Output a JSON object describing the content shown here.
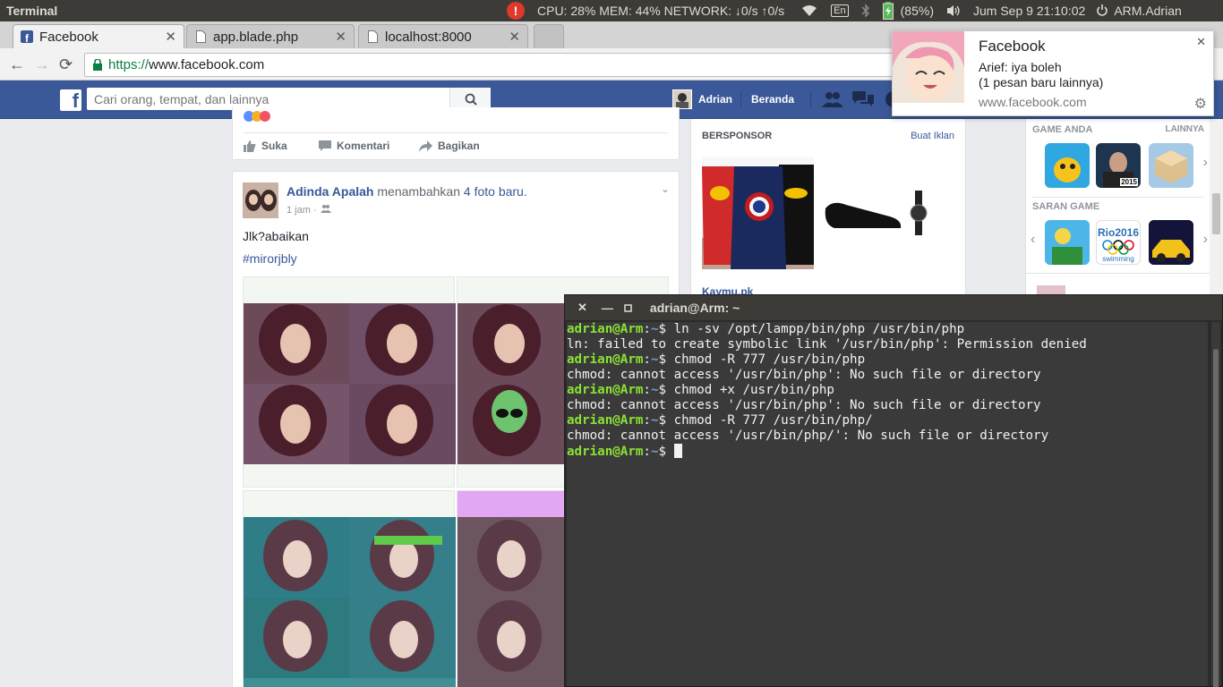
{
  "panel": {
    "app_title": "Terminal",
    "system_stats": "CPU: 28% MEM: 44% NETWORK: ↓0/s ↑0/s",
    "keyboard_layout": "En",
    "battery": "(85%)",
    "datetime": "Jum Sep  9 21:10:02",
    "user": "ARM.Adrian"
  },
  "browser": {
    "tabs": [
      {
        "label": "Facebook",
        "icon": "facebook-icon",
        "active": true
      },
      {
        "label": "app.blade.php",
        "icon": "page-icon",
        "active": false
      },
      {
        "label": "localhost:8000",
        "icon": "page-icon",
        "active": false
      }
    ],
    "url_scheme": "https://",
    "url_host": "www.facebook.com"
  },
  "facebook": {
    "search_placeholder": "Cari orang, tempat, dan lainnya",
    "user_name": "Adrian",
    "home_label": "Beranda",
    "prev_post": {
      "like_label": "Suka",
      "comment_label": "Komentari",
      "share_label": "Bagikan"
    },
    "post": {
      "author": "Adinda Apalah",
      "action": "menambahkan",
      "action_link": "4 foto baru.",
      "time": "1 jam ·",
      "text": "Jlk?abaikan",
      "hashtag": "#mirorjbly"
    },
    "sponsor": {
      "title": "BERSPONSOR",
      "create_ad": "Buat Iklan",
      "advertiser": "Kaymu.pk"
    },
    "games": {
      "your_games": "GAME ANDA",
      "more": "LAINNYA",
      "suggested": "SARAN GAME",
      "game_year_badge": "2015",
      "rio_label": "Rio2016",
      "rio_sub": "swimming"
    }
  },
  "notification": {
    "title": "Facebook",
    "line1": "Arief: iya boleh",
    "line2": "(1 pesan baru lainnya)",
    "source": "www.facebook.com"
  },
  "terminal": {
    "title": "adrian@Arm: ~",
    "prompt_user": "adrian@Arm",
    "prompt_sep": ":",
    "prompt_dir": "~",
    "prompt_end": "$",
    "lines": [
      {
        "type": "cmd",
        "text": " ln -sv /opt/lampp/bin/php /usr/bin/php"
      },
      {
        "type": "out",
        "text": "ln: failed to create symbolic link '/usr/bin/php': Permission denied"
      },
      {
        "type": "cmd",
        "text": " chmod -R 777 /usr/bin/php"
      },
      {
        "type": "out",
        "text": "chmod: cannot access '/usr/bin/php': No such file or directory"
      },
      {
        "type": "cmd",
        "text": " chmod +x /usr/bin/php"
      },
      {
        "type": "out",
        "text": "chmod: cannot access '/usr/bin/php': No such file or directory"
      },
      {
        "type": "cmd",
        "text": " chmod -R 777 /usr/bin/php/"
      },
      {
        "type": "out",
        "text": "chmod: cannot access '/usr/bin/php/': No such file or directory"
      },
      {
        "type": "cmd",
        "text": " "
      }
    ]
  },
  "colors": {
    "facebook_blue": "#3b5998",
    "terminal_bg": "#3a3a3a",
    "prompt_green": "#8ae234",
    "prompt_blue": "#729fcf",
    "panel_bg": "#3c3b37"
  }
}
